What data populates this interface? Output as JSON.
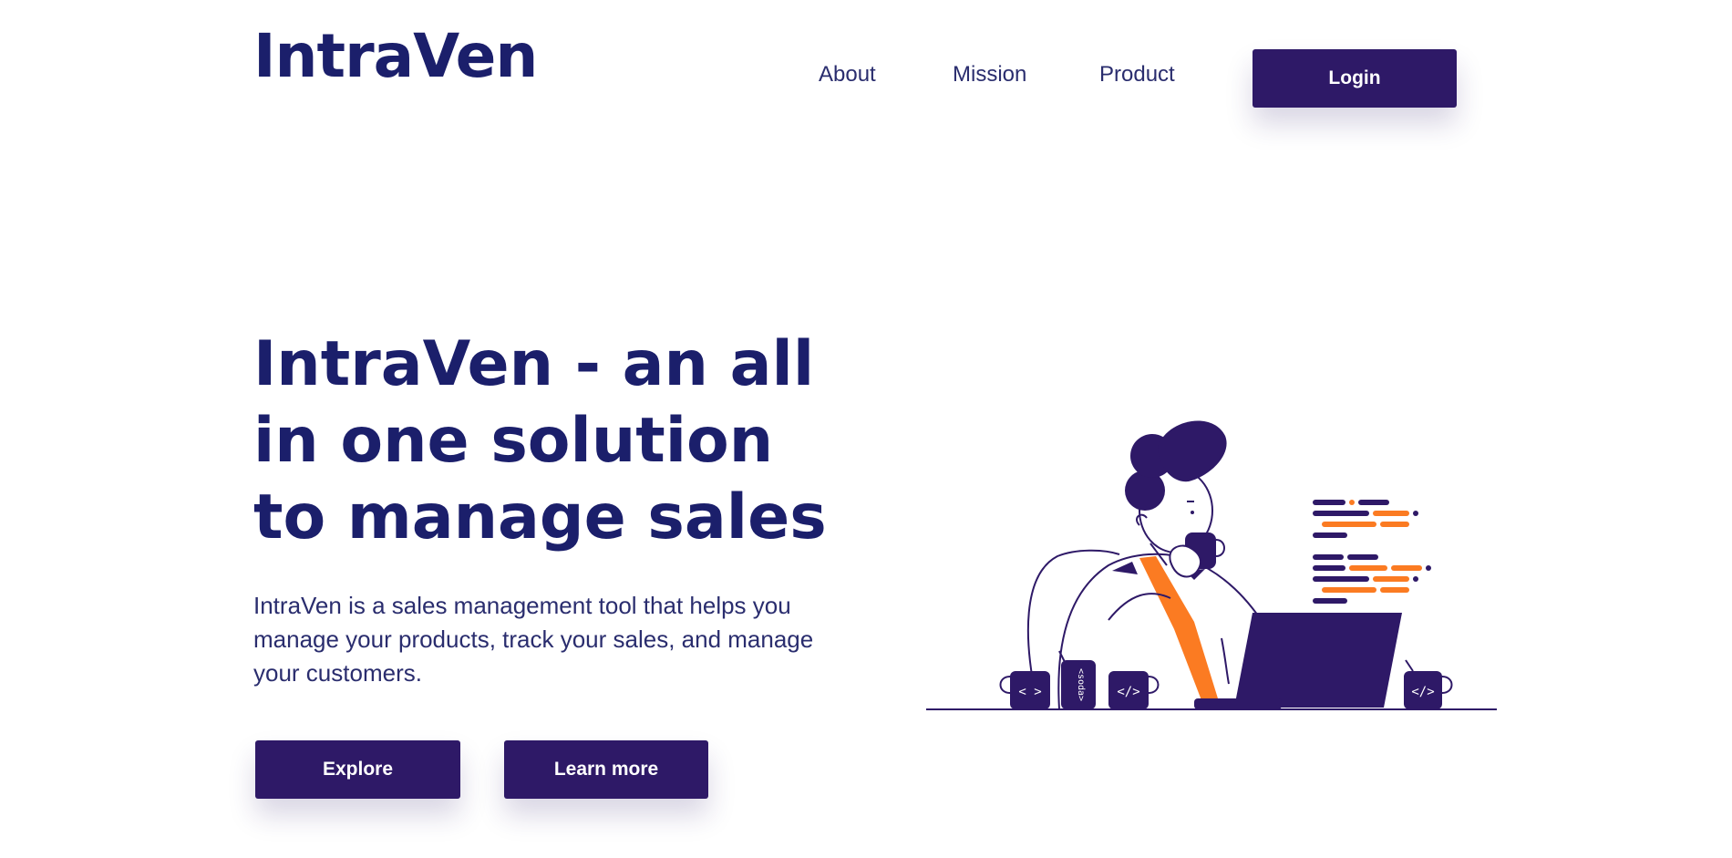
{
  "header": {
    "logo": "IntraVen",
    "nav": [
      {
        "label": "About"
      },
      {
        "label": "Mission"
      },
      {
        "label": "Product"
      }
    ],
    "login_label": "Login"
  },
  "hero": {
    "title": "IntraVen - an all in one solution to manage sales",
    "description": "IntraVen is a sales management tool that helps you manage your products, track your sales, and manage your customers.",
    "explore_label": "Explore",
    "learn_more_label": "Learn more"
  },
  "illustration": {
    "mug_labels": [
      "< >",
      "</>",
      "</>"
    ],
    "can_label": "<soda>"
  },
  "colors": {
    "primary": "#2e1967",
    "heading": "#1b1f6b",
    "accent": "#fb7b22",
    "background": "#ffffff"
  }
}
